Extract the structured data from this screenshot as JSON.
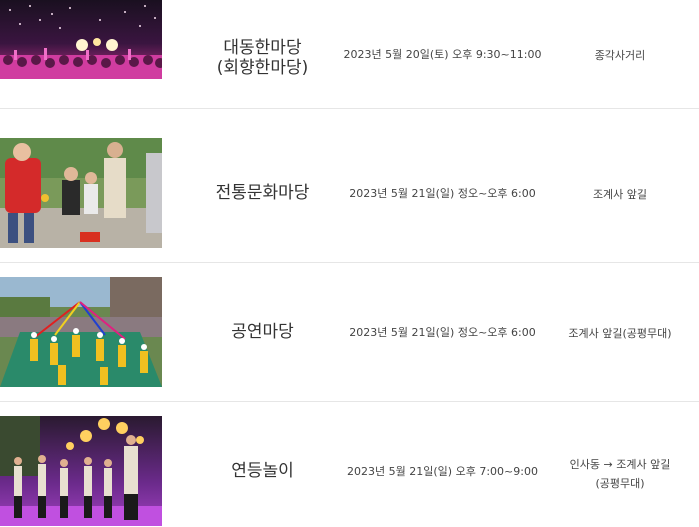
{
  "events": [
    {
      "name": "대동한마당\n(회향한마당)",
      "datetime": "2023년 5월 20일(토) 오후 9:30~11:00",
      "place": "종각사거리",
      "photo": "concert-crowd-photo"
    },
    {
      "name": "전통문화마당",
      "datetime": "2023년 5월 21일(일) 정오~오후 6:00",
      "place": "조계사 앞길",
      "photo": "traditional-games-photo"
    },
    {
      "name": "공연마당",
      "datetime": "2023년 5월 21일(일) 정오~오후 6:00",
      "place": "조계사 앞길(공평무대)",
      "photo": "street-performance-photo"
    },
    {
      "name": "연등놀이",
      "datetime": "2023년 5월 21일(일) 오후 7:00~9:00",
      "place": "인사동 → 조계사 앞길\n(공평무대)",
      "photo": "lantern-dance-photo"
    }
  ]
}
